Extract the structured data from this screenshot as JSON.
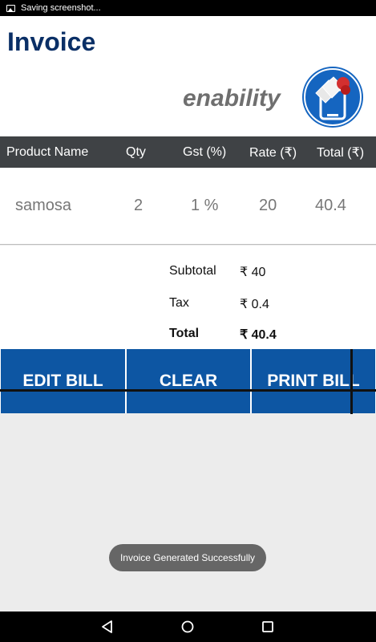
{
  "status_bar": {
    "notification": "Saving screenshot..."
  },
  "header": {
    "title": "Invoice",
    "brand": "enability"
  },
  "table": {
    "columns": [
      "Product Name",
      "Qty",
      "Gst (%)",
      "Rate (₹)",
      "Total (₹)"
    ],
    "rows": [
      {
        "product": "samosa",
        "qty": "2",
        "gst": "1 %",
        "rate": "20",
        "total": "40.4"
      }
    ]
  },
  "summary": {
    "subtotal_label": "Subtotal",
    "subtotal_value": "₹ 40",
    "tax_label": "Tax",
    "tax_value": "₹ 0.4",
    "total_label": "Total",
    "total_value": "₹ 40.4"
  },
  "buttons": {
    "edit": "EDIT BILL",
    "clear": "CLEAR",
    "print": "PRINT BILL"
  },
  "toast": "Invoice Generated Successfully",
  "colors": {
    "title": "#0a2f66",
    "button": "#0d56a3",
    "table_header": "#3f4245",
    "logo_circle": "#1565c0"
  },
  "icons": {
    "status": "image-icon",
    "logo": "enability-logo",
    "back": "back-icon",
    "home": "home-icon",
    "recents": "recents-icon"
  }
}
